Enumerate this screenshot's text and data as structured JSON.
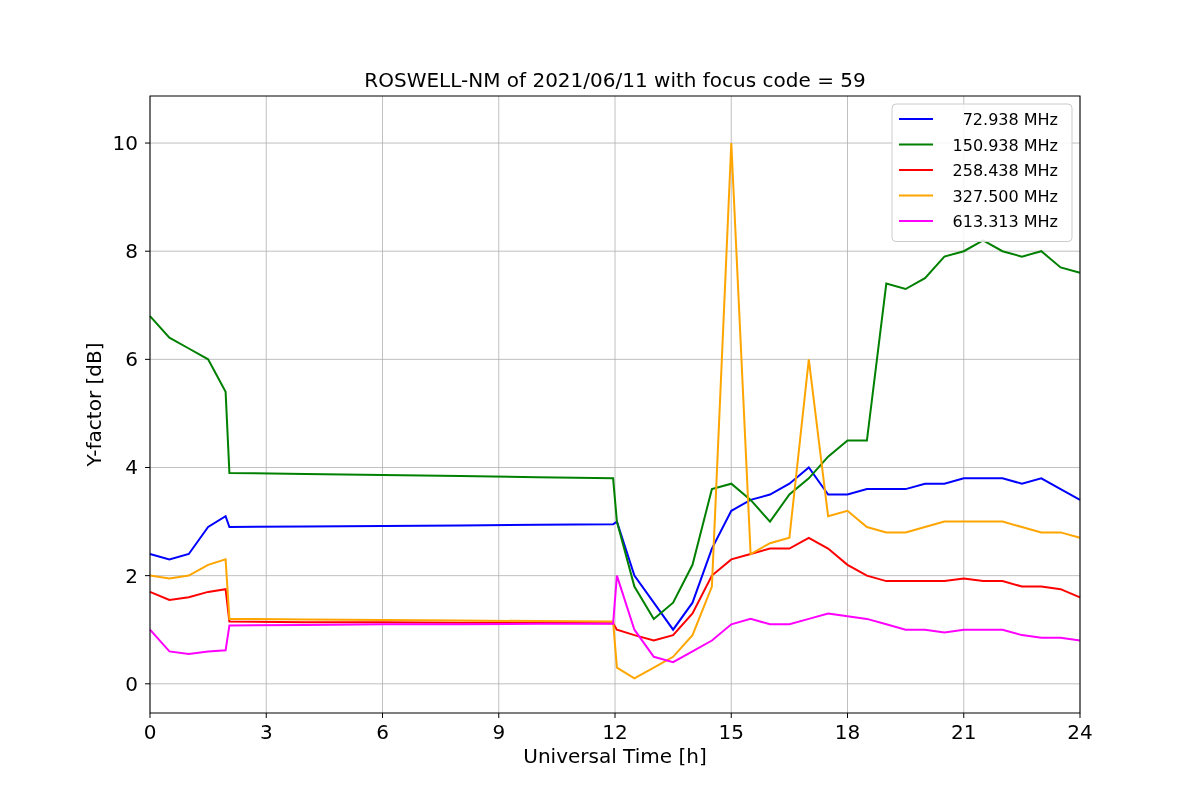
{
  "chart_data": {
    "type": "line",
    "title": "ROSWELL-NM of 2021/06/11 with focus code = 59",
    "xlabel": "Universal Time [h]",
    "ylabel": "Y-factor [dB]",
    "x": [
      0,
      0.5,
      1,
      1.5,
      1.95,
      2.05,
      4,
      6,
      8,
      10,
      11.95,
      12.05,
      12.5,
      13,
      13.5,
      14,
      14.5,
      15,
      15.5,
      16,
      16.5,
      17,
      17.5,
      18,
      18.5,
      19,
      19.5,
      20,
      20.5,
      21,
      21.5,
      22,
      22.5,
      23,
      23.5,
      24
    ],
    "series": [
      {
        "name": "72.938 MHz",
        "color": "#0000ff",
        "values": [
          2.4,
          2.3,
          2.4,
          2.9,
          3.1,
          2.9,
          2.91,
          2.92,
          2.93,
          2.94,
          2.95,
          3.0,
          2.0,
          1.5,
          1.0,
          1.5,
          2.5,
          3.2,
          3.4,
          3.5,
          3.7,
          4.0,
          3.5,
          3.5,
          3.6,
          3.6,
          3.6,
          3.7,
          3.7,
          3.8,
          3.8,
          3.8,
          3.7,
          3.8,
          3.6,
          3.4
        ]
      },
      {
        "name": "150.938 MHz",
        "color": "#008000",
        "values": [
          6.8,
          6.4,
          6.2,
          6.0,
          5.4,
          3.9,
          3.88,
          3.86,
          3.84,
          3.82,
          3.8,
          3.0,
          1.8,
          1.2,
          1.5,
          2.2,
          3.6,
          3.7,
          3.4,
          3.0,
          3.5,
          3.8,
          4.2,
          4.5,
          4.5,
          7.4,
          7.3,
          7.5,
          7.9,
          8.0,
          8.2,
          8.0,
          7.9,
          8.0,
          7.7,
          7.6
        ]
      },
      {
        "name": "258.438 MHz",
        "color": "#ff0000",
        "values": [
          1.7,
          1.55,
          1.6,
          1.7,
          1.75,
          1.15,
          1.14,
          1.14,
          1.13,
          1.13,
          1.12,
          1.0,
          0.9,
          0.8,
          0.9,
          1.3,
          2.0,
          2.3,
          2.4,
          2.5,
          2.5,
          2.7,
          2.5,
          2.2,
          2.0,
          1.9,
          1.9,
          1.9,
          1.9,
          1.95,
          1.9,
          1.9,
          1.8,
          1.8,
          1.75,
          1.6
        ]
      },
      {
        "name": "327.500 MHz",
        "color": "#ffa500",
        "values": [
          2.0,
          1.95,
          2.0,
          2.2,
          2.3,
          1.2,
          1.19,
          1.18,
          1.17,
          1.16,
          1.15,
          0.3,
          0.1,
          0.3,
          0.5,
          0.9,
          1.8,
          10.0,
          2.4,
          2.6,
          2.7,
          6.0,
          3.1,
          3.2,
          2.9,
          2.8,
          2.8,
          2.9,
          3.0,
          3.0,
          3.0,
          3.0,
          2.9,
          2.8,
          2.8,
          2.7
        ]
      },
      {
        "name": "613.313 MHz",
        "color": "#ff00ff",
        "values": [
          1.0,
          0.6,
          0.55,
          0.6,
          0.62,
          1.08,
          1.09,
          1.1,
          1.1,
          1.11,
          1.11,
          2.0,
          1.0,
          0.5,
          0.4,
          0.6,
          0.8,
          1.1,
          1.2,
          1.1,
          1.1,
          1.2,
          1.3,
          1.25,
          1.2,
          1.1,
          1.0,
          1.0,
          0.95,
          1.0,
          1.0,
          1.0,
          0.9,
          0.85,
          0.85,
          0.8
        ]
      }
    ],
    "grid": true,
    "legend": true,
    "xlim": [
      0,
      24
    ],
    "ylim": [
      -0.54,
      10.87
    ],
    "xticks": [
      0,
      3,
      6,
      9,
      12,
      15,
      18,
      21,
      24
    ],
    "yticks": [
      0,
      2,
      4,
      6,
      8,
      10
    ]
  }
}
